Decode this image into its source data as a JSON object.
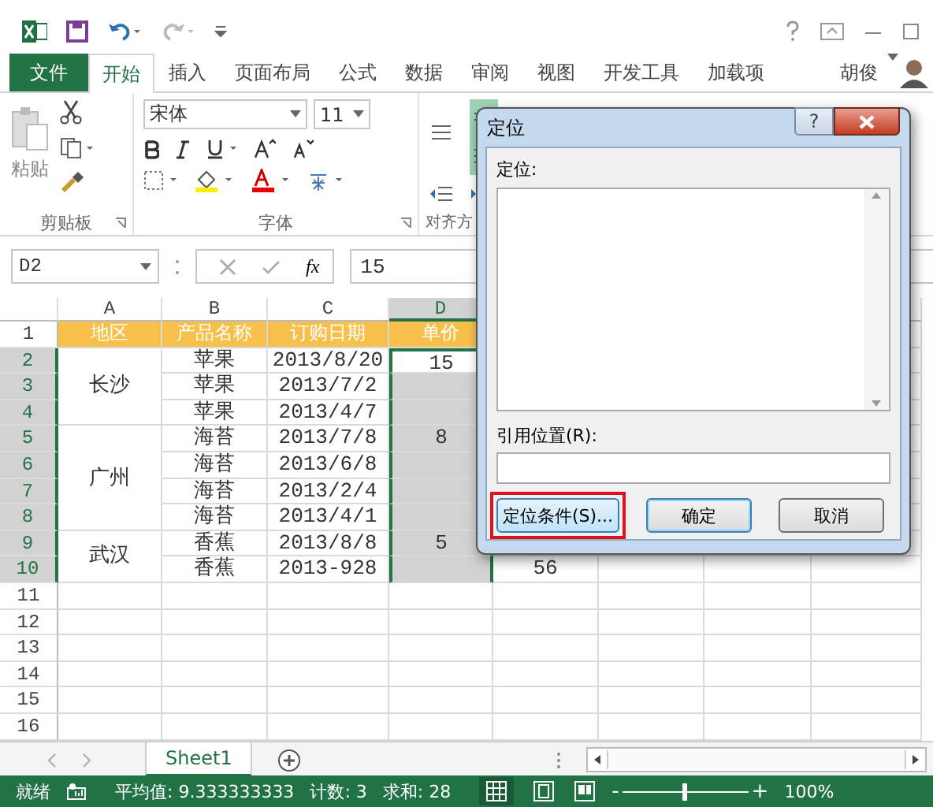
{
  "tabs": [
    {
      "label": "文件",
      "kind": "file",
      "selected": false
    },
    {
      "label": "开始",
      "kind": "tab",
      "selected": true
    },
    {
      "label": "插入",
      "kind": "tab",
      "selected": false
    },
    {
      "label": "页面布局",
      "kind": "tab",
      "selected": false
    },
    {
      "label": "公式",
      "kind": "tab",
      "selected": false
    },
    {
      "label": "数据",
      "kind": "tab",
      "selected": false
    },
    {
      "label": "审阅",
      "kind": "tab",
      "selected": false
    },
    {
      "label": "视图",
      "kind": "tab",
      "selected": false
    },
    {
      "label": "开发工具",
      "kind": "tab",
      "selected": false
    },
    {
      "label": "加载项",
      "kind": "tab",
      "selected": false
    }
  ],
  "user": {
    "name": "胡俊"
  },
  "ribbon": {
    "paste_label": "粘贴",
    "font_name": "宋体",
    "font_size": "11",
    "groups": [
      "剪贴板",
      "字体",
      "对齐方"
    ]
  },
  "formula_bar": {
    "name_box": "D2",
    "fx": "fx",
    "value": "15"
  },
  "sheet": {
    "columns": [
      {
        "label": "A",
        "selected": false
      },
      {
        "label": "B",
        "selected": false
      },
      {
        "label": "C",
        "selected": false
      },
      {
        "label": "D",
        "selected": true
      }
    ],
    "rows": [
      {
        "label": "1",
        "selected": false
      },
      {
        "label": "2",
        "selected": true
      },
      {
        "label": "3",
        "selected": true
      },
      {
        "label": "4",
        "selected": true
      },
      {
        "label": "5",
        "selected": true
      },
      {
        "label": "6",
        "selected": true
      },
      {
        "label": "7",
        "selected": true
      },
      {
        "label": "8",
        "selected": true
      },
      {
        "label": "9",
        "selected": true
      },
      {
        "label": "10",
        "selected": true
      },
      {
        "label": "11",
        "selected": false
      },
      {
        "label": "12",
        "selected": false
      },
      {
        "label": "13",
        "selected": false
      },
      {
        "label": "14",
        "selected": false
      },
      {
        "label": "15",
        "selected": false
      },
      {
        "label": "16",
        "selected": false
      }
    ],
    "header": [
      "地区",
      "产品名称",
      "订购日期",
      "单价"
    ],
    "groups": [
      {
        "region": "长沙",
        "items": [
          {
            "product": "苹果",
            "date": "2013/8/20",
            "price": "15",
            "selected": true,
            "active": true
          },
          {
            "product": "苹果",
            "date": "2013/7/2",
            "selected": true,
            "active": false
          },
          {
            "product": "苹果",
            "date": "2013/4/7",
            "selected": true,
            "active": false
          }
        ]
      },
      {
        "region": "广州",
        "items": [
          {
            "product": "海苔",
            "date": "2013/7/8",
            "price": "8",
            "selected": true,
            "active": false
          },
          {
            "product": "海苔",
            "date": "2013/6/8",
            "selected": true,
            "active": false
          },
          {
            "product": "海苔",
            "date": "2013/2/4",
            "selected": true,
            "active": false
          },
          {
            "product": "海苔",
            "date": "2013/4/1",
            "selected": true,
            "active": false
          }
        ]
      },
      {
        "region": "武汉",
        "items": [
          {
            "product": "香蕉",
            "date": "2013/8/8",
            "price": "5",
            "selected": true,
            "active": false
          },
          {
            "product": "香蕉",
            "date": "2013-928",
            "selected": true,
            "active": false,
            "column_e": "56"
          }
        ]
      }
    ]
  },
  "sheet_tabs": [
    {
      "label": "Sheet1",
      "selected": true
    }
  ],
  "dialog": {
    "title": "定位",
    "help": "?",
    "list_label": "定位:",
    "reference_label": "引用位置(R):",
    "buttons": [
      {
        "label": "定位条件(S)...",
        "kind": "special",
        "highlighted": true
      },
      {
        "label": "确定",
        "kind": "default",
        "highlighted": false
      },
      {
        "label": "取消",
        "kind": "normal",
        "highlighted": false
      }
    ]
  },
  "status_bar": {
    "state": "就绪",
    "average": "平均值: 9.333333333",
    "count": "计数: 3",
    "sum": "求和: 28",
    "zoom_out": "-",
    "zoom_in": "+",
    "zoom": {
      "level": 0.5
    },
    "zoom_label": "100%"
  }
}
